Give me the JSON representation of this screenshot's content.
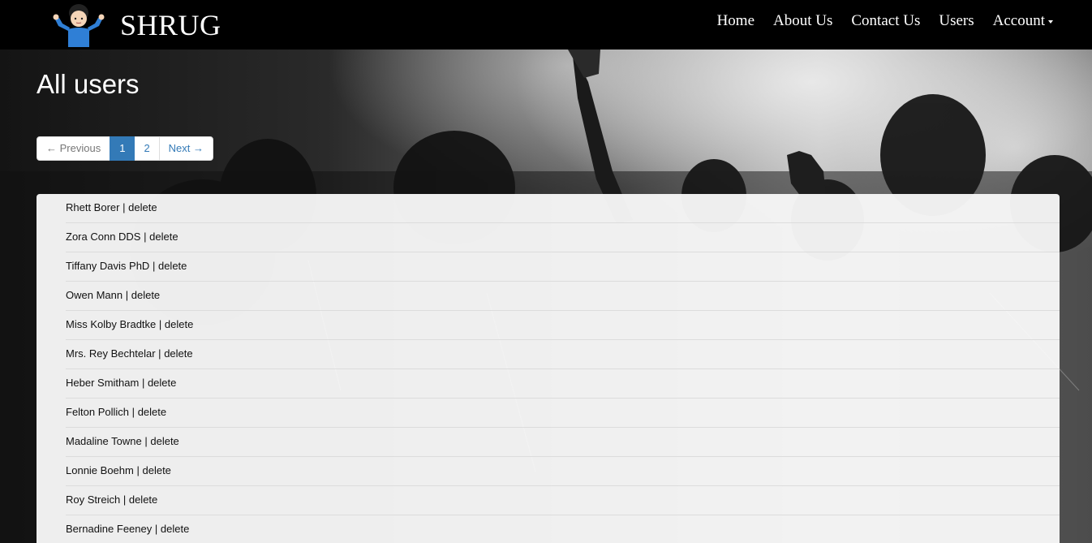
{
  "brand": {
    "title": "SHRUG",
    "logo_icon": "shrug-person-icon"
  },
  "nav": {
    "items": [
      "Home",
      "About Us",
      "Contact Us",
      "Users"
    ],
    "account_label": "Account"
  },
  "page": {
    "title": "All users"
  },
  "pagination": {
    "previous_label": "← Previous",
    "pages": [
      "1",
      "2"
    ],
    "current_page": "1",
    "next_label": "Next →"
  },
  "users": [
    {
      "name": "Rhett Borer",
      "sep": "|",
      "action": "delete"
    },
    {
      "name": "Zora Conn DDS",
      "sep": "|",
      "action": "delete"
    },
    {
      "name": "Tiffany Davis PhD",
      "sep": "|",
      "action": "delete"
    },
    {
      "name": "Owen Mann",
      "sep": "|",
      "action": "delete"
    },
    {
      "name": "Miss Kolby Bradtke",
      "sep": "|",
      "action": "delete"
    },
    {
      "name": "Mrs. Rey Bechtelar",
      "sep": "|",
      "action": "delete"
    },
    {
      "name": "Heber Smitham",
      "sep": "|",
      "action": "delete"
    },
    {
      "name": "Felton Pollich",
      "sep": "|",
      "action": "delete"
    },
    {
      "name": "Madaline Towne",
      "sep": "|",
      "action": "delete"
    },
    {
      "name": "Lonnie Boehm",
      "sep": "|",
      "action": "delete"
    },
    {
      "name": "Roy Streich",
      "sep": "|",
      "action": "delete"
    },
    {
      "name": "Bernadine Feeney",
      "sep": "|",
      "action": "delete"
    }
  ],
  "colors": {
    "navbar_bg": "#000000",
    "pagination_active": "#337ab7",
    "link": "#337ab7",
    "panel_bg": "#fafafa"
  }
}
